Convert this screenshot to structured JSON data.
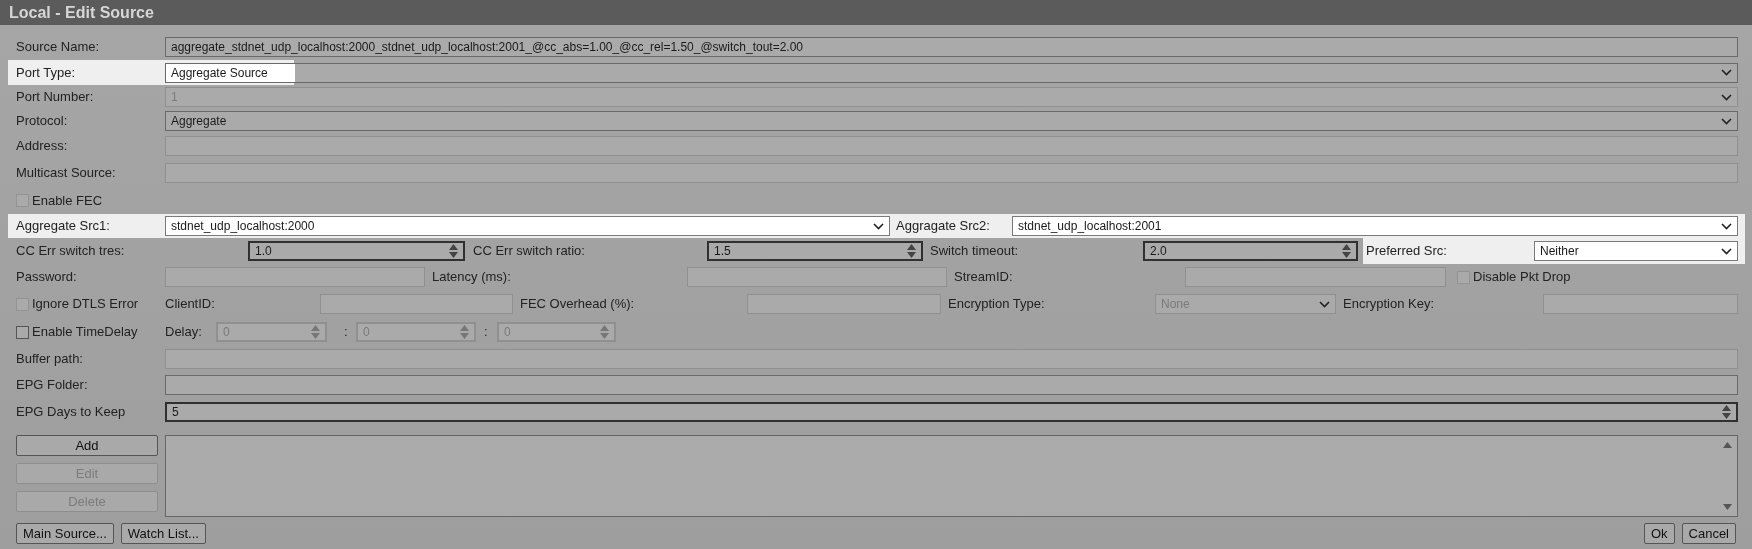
{
  "window": {
    "title": "Local - Edit Source"
  },
  "rows": [
    {
      "highlighted": false,
      "items": [
        {
          "kind": "label",
          "text": "Source Name:"
        },
        {
          "kind": "text",
          "value": "aggregate_stdnet_udp_localhost:2000_stdnet_udp_localhost:2001_@cc_abs=1.00_@cc_rel=1.50_@switch_tout=2.00",
          "disabled": false
        }
      ]
    },
    {
      "highlighted": true,
      "items": [
        {
          "kind": "label",
          "text": "Port Type:"
        },
        {
          "kind": "select",
          "value": "Aggregate Source",
          "disabled": false
        }
      ]
    },
    {
      "highlighted": false,
      "items": [
        {
          "kind": "label",
          "text": "Port Number:"
        },
        {
          "kind": "select",
          "value": "1",
          "disabled": true
        }
      ]
    },
    {
      "highlighted": false,
      "items": [
        {
          "kind": "label",
          "text": "Protocol:"
        },
        {
          "kind": "select",
          "value": "Aggregate",
          "disabled": false
        }
      ]
    },
    {
      "highlighted": false,
      "items": [
        {
          "kind": "label",
          "text": "Address:"
        },
        {
          "kind": "text",
          "disabled": true
        }
      ]
    },
    {
      "highlighted": false,
      "items": [
        {
          "kind": "label",
          "text": "Multicast Source:"
        },
        {
          "kind": "text",
          "disabled": true
        }
      ]
    },
    {
      "highlighted": false,
      "items": [
        {
          "kind": "checkbox",
          "text": "Enable FEC",
          "checked": false,
          "disabled": true
        }
      ]
    },
    {
      "highlighted": true,
      "items": [
        {
          "kind": "label",
          "text": "Aggregate Src1:"
        },
        {
          "kind": "select",
          "value": "stdnet_udp_localhost:2000",
          "disabled": false
        },
        {
          "kind": "label",
          "text": "Aggragate Src2:"
        },
        {
          "kind": "select",
          "value": "stdnet_udp_localhost:2001",
          "disabled": false
        }
      ]
    },
    {
      "highlighted": true,
      "items": [
        {
          "kind": "label",
          "text": "CC Err switch tres:"
        },
        {
          "kind": "number",
          "value": "1.0",
          "disabled": false
        },
        {
          "kind": "label",
          "text": "CC Err switch ratio:"
        },
        {
          "kind": "number",
          "value": "1.5",
          "disabled": false
        },
        {
          "kind": "label",
          "text": "Switch timeout:"
        },
        {
          "kind": "number",
          "value": "2.0",
          "disabled": false
        },
        {
          "kind": "label",
          "text": "Preferred Src:"
        },
        {
          "kind": "select",
          "value": "Neither",
          "disabled": false
        }
      ]
    },
    {
      "highlighted": false,
      "items": [
        {
          "kind": "label",
          "text": "Password:"
        },
        {
          "kind": "text",
          "disabled": true
        },
        {
          "kind": "label",
          "text": "Latency (ms):"
        },
        {
          "kind": "text",
          "disabled": true
        },
        {
          "kind": "label",
          "text": "StreamID:"
        },
        {
          "kind": "text",
          "disabled": true
        },
        {
          "kind": "checkbox",
          "text": "Disable Pkt Drop",
          "checked": false,
          "disabled": true
        }
      ]
    },
    {
      "highlighted": false,
      "items": [
        {
          "kind": "checkbox",
          "text": "Ignore DTLS Error",
          "checked": false,
          "disabled": true
        },
        {
          "kind": "label",
          "text": "ClientID:"
        },
        {
          "kind": "text",
          "disabled": true
        },
        {
          "kind": "label",
          "text": "FEC Overhead (%):"
        },
        {
          "kind": "text",
          "disabled": true
        },
        {
          "kind": "label",
          "text": "Encryption Type:"
        },
        {
          "kind": "select",
          "value": "None",
          "disabled": true
        },
        {
          "kind": "label",
          "text": "Encryption Key:"
        },
        {
          "kind": "text",
          "disabled": true
        }
      ]
    },
    {
      "highlighted": false,
      "items": [
        {
          "kind": "checkbox",
          "text": "Enable TimeDelay",
          "checked": false,
          "disabled": false
        },
        {
          "kind": "label",
          "text": "Delay:"
        },
        {
          "kind": "number",
          "value": "0",
          "disabled": true
        },
        {
          "kind": "label",
          "text": ":"
        },
        {
          "kind": "number",
          "value": "0",
          "disabled": true
        },
        {
          "kind": "label",
          "text": ":"
        },
        {
          "kind": "number",
          "value": "0",
          "disabled": true
        }
      ]
    },
    {
      "highlighted": false,
      "items": [
        {
          "kind": "label",
          "text": "Buffer path:"
        },
        {
          "kind": "text",
          "disabled": true
        }
      ]
    },
    {
      "highlighted": false,
      "items": [
        {
          "kind": "label",
          "text": "EPG Folder:"
        },
        {
          "kind": "text",
          "disabled": false
        }
      ]
    },
    {
      "highlighted": false,
      "items": [
        {
          "kind": "label",
          "text": "EPG Days to Keep"
        },
        {
          "kind": "number",
          "value": "5",
          "disabled": false
        }
      ]
    }
  ],
  "side_buttons": [
    {
      "label": "Add",
      "disabled": false
    },
    {
      "label": "Edit",
      "disabled": true
    },
    {
      "label": "Delete",
      "disabled": true
    }
  ],
  "footer_left": [
    {
      "label": "Main Source...",
      "disabled": false
    },
    {
      "label": "Watch List...",
      "disabled": false
    }
  ],
  "footer_right": [
    {
      "label": "Ok",
      "disabled": false
    },
    {
      "label": "Cancel",
      "disabled": false
    }
  ]
}
